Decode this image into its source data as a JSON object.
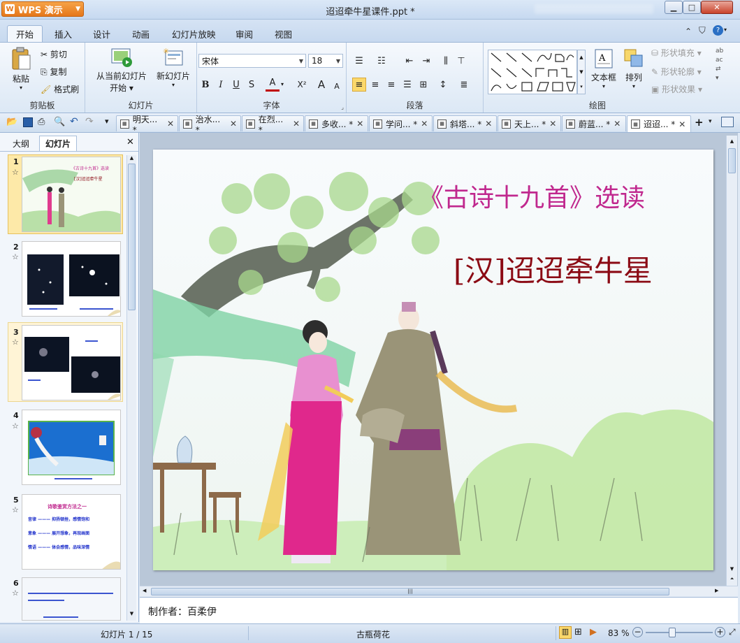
{
  "app": {
    "name": "WPS 演示",
    "window_title": "迢迢牵牛星课件.ppt *"
  },
  "ribbon_tabs": [
    "开始",
    "插入",
    "设计",
    "动画",
    "幻灯片放映",
    "审阅",
    "视图"
  ],
  "clipboard": {
    "paste": "粘贴",
    "cut": "剪切",
    "copy": "复制",
    "format_painter": "格式刷",
    "group": "剪贴板"
  },
  "slides_group": {
    "from_current": "从当前幻灯片",
    "start": "开始",
    "new_slide": "新幻灯片",
    "group": "幻灯片"
  },
  "font": {
    "name": "宋体",
    "size": "18",
    "group": "字体",
    "bold": "B",
    "italic": "I",
    "underline": "U",
    "shadow": "S",
    "color": "A",
    "superscript": "X²",
    "grow": "A",
    "shrink": "A"
  },
  "paragraph": {
    "group": "段落"
  },
  "drawing": {
    "textbox": "文本框",
    "arrange": "排列",
    "shape_fill": "形状填充",
    "shape_outline": "形状轮廓",
    "shape_effect": "形状效果",
    "group": "绘图"
  },
  "doc_tabs": [
    "明天... *",
    "治水... *",
    "在烈... *",
    "多收... *",
    "学问... *",
    "斜塔... *",
    "天上... *",
    "蔚蓝... *",
    "迢迢... *"
  ],
  "panel": {
    "tab_outline": "大纲",
    "tab_slides": "幻灯片"
  },
  "thumbnails": [
    {
      "num": "1",
      "caption": ""
    },
    {
      "num": "2",
      "caption": ""
    },
    {
      "num": "3",
      "caption": ""
    },
    {
      "num": "4",
      "caption": ""
    },
    {
      "num": "5",
      "caption": "诗歌鉴赏方法之一",
      "lines": [
        "音律 ——— 抑扬顿挫，感情饱和",
        "意象 ——— 展开想象，再现画面",
        "情语 ——— 体会感情，品味深情"
      ]
    },
    {
      "num": "6",
      "caption": ""
    }
  ],
  "slide": {
    "title": "《古诗十九首》选读",
    "subtitle": "[汉]迢迢牵牛星",
    "title_color": "#c0288e",
    "subtitle_color": "#8b0a14"
  },
  "notes": "制作者：百柔伊",
  "status": {
    "slide_count": "幻灯片 1 / 15",
    "theme": "古瓶荷花",
    "zoom": "83 %"
  }
}
